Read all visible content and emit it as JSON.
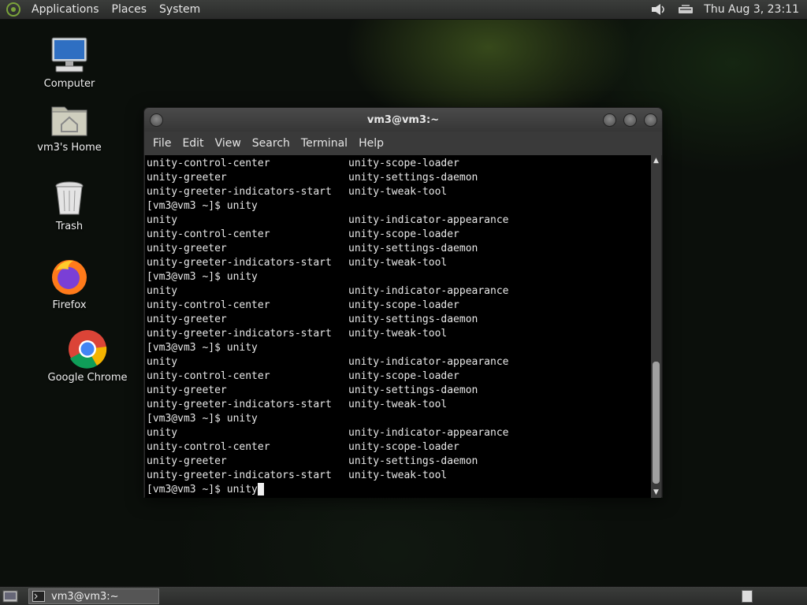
{
  "top_panel": {
    "menus": [
      "Applications",
      "Places",
      "System"
    ],
    "clock": "Thu Aug  3, 23:11",
    "icons": [
      "distro-logo-icon",
      "volume-icon",
      "network-icon"
    ]
  },
  "desktop_icons": [
    {
      "label": "Computer",
      "icon": "computer-icon"
    },
    {
      "label": "vm3's Home",
      "icon": "home-folder-icon"
    },
    {
      "label": "Trash",
      "icon": "trash-icon"
    },
    {
      "label": "Firefox",
      "icon": "firefox-icon"
    },
    {
      "label": "Google Chrome",
      "icon": "chrome-icon"
    }
  ],
  "terminal": {
    "title": "vm3@vm3:~",
    "menu": [
      "File",
      "Edit",
      "View",
      "Search",
      "Terminal",
      "Help"
    ],
    "lines": [
      [
        "unity-control-center",
        "unity-scope-loader"
      ],
      [
        "unity-greeter",
        "unity-settings-daemon"
      ],
      [
        "unity-greeter-indicators-start",
        "unity-tweak-tool"
      ],
      [
        "[vm3@vm3 ~]$ unity",
        ""
      ],
      [
        "unity",
        "unity-indicator-appearance"
      ],
      [
        "unity-control-center",
        "unity-scope-loader"
      ],
      [
        "unity-greeter",
        "unity-settings-daemon"
      ],
      [
        "unity-greeter-indicators-start",
        "unity-tweak-tool"
      ],
      [
        "[vm3@vm3 ~]$ unity",
        ""
      ],
      [
        "unity",
        "unity-indicator-appearance"
      ],
      [
        "unity-control-center",
        "unity-scope-loader"
      ],
      [
        "unity-greeter",
        "unity-settings-daemon"
      ],
      [
        "unity-greeter-indicators-start",
        "unity-tweak-tool"
      ],
      [
        "[vm3@vm3 ~]$ unity",
        ""
      ],
      [
        "unity",
        "unity-indicator-appearance"
      ],
      [
        "unity-control-center",
        "unity-scope-loader"
      ],
      [
        "unity-greeter",
        "unity-settings-daemon"
      ],
      [
        "unity-greeter-indicators-start",
        "unity-tweak-tool"
      ],
      [
        "[vm3@vm3 ~]$ unity",
        ""
      ],
      [
        "unity",
        "unity-indicator-appearance"
      ],
      [
        "unity-control-center",
        "unity-scope-loader"
      ],
      [
        "unity-greeter",
        "unity-settings-daemon"
      ],
      [
        "unity-greeter-indicators-start",
        "unity-tweak-tool"
      ]
    ],
    "prompt": "[vm3@vm3 ~]$ unity"
  },
  "taskbar": {
    "task_label": "vm3@vm3:~"
  }
}
